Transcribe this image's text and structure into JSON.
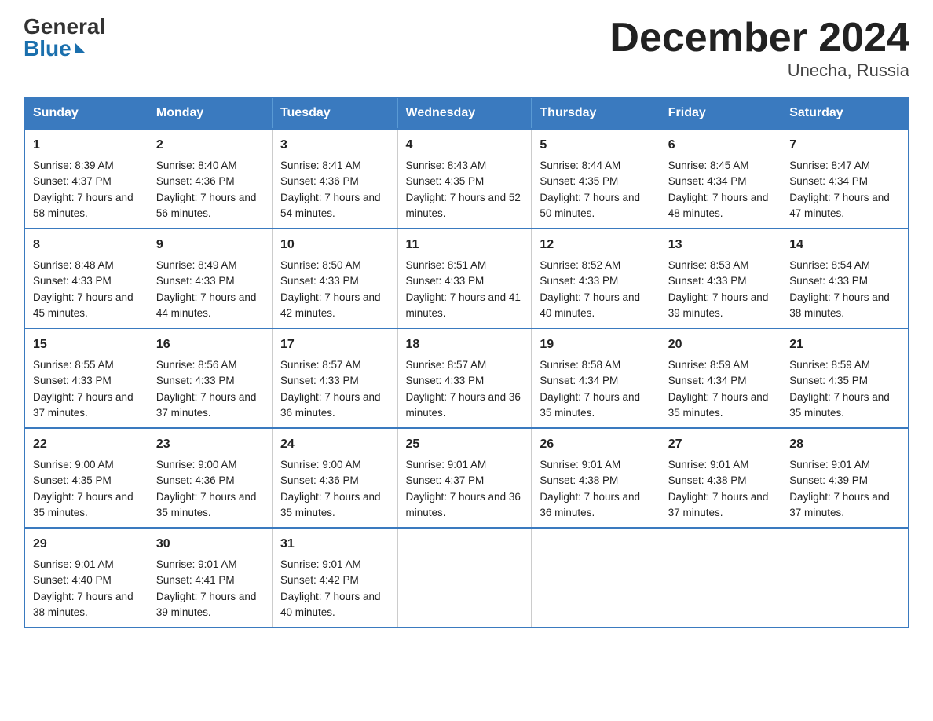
{
  "logo": {
    "general": "General",
    "blue": "Blue"
  },
  "title": "December 2024",
  "subtitle": "Unecha, Russia",
  "days_header": [
    "Sunday",
    "Monday",
    "Tuesday",
    "Wednesday",
    "Thursday",
    "Friday",
    "Saturday"
  ],
  "weeks": [
    [
      {
        "day": "1",
        "sunrise": "8:39 AM",
        "sunset": "4:37 PM",
        "daylight": "7 hours and 58 minutes."
      },
      {
        "day": "2",
        "sunrise": "8:40 AM",
        "sunset": "4:36 PM",
        "daylight": "7 hours and 56 minutes."
      },
      {
        "day": "3",
        "sunrise": "8:41 AM",
        "sunset": "4:36 PM",
        "daylight": "7 hours and 54 minutes."
      },
      {
        "day": "4",
        "sunrise": "8:43 AM",
        "sunset": "4:35 PM",
        "daylight": "7 hours and 52 minutes."
      },
      {
        "day": "5",
        "sunrise": "8:44 AM",
        "sunset": "4:35 PM",
        "daylight": "7 hours and 50 minutes."
      },
      {
        "day": "6",
        "sunrise": "8:45 AM",
        "sunset": "4:34 PM",
        "daylight": "7 hours and 48 minutes."
      },
      {
        "day": "7",
        "sunrise": "8:47 AM",
        "sunset": "4:34 PM",
        "daylight": "7 hours and 47 minutes."
      }
    ],
    [
      {
        "day": "8",
        "sunrise": "8:48 AM",
        "sunset": "4:33 PM",
        "daylight": "7 hours and 45 minutes."
      },
      {
        "day": "9",
        "sunrise": "8:49 AM",
        "sunset": "4:33 PM",
        "daylight": "7 hours and 44 minutes."
      },
      {
        "day": "10",
        "sunrise": "8:50 AM",
        "sunset": "4:33 PM",
        "daylight": "7 hours and 42 minutes."
      },
      {
        "day": "11",
        "sunrise": "8:51 AM",
        "sunset": "4:33 PM",
        "daylight": "7 hours and 41 minutes."
      },
      {
        "day": "12",
        "sunrise": "8:52 AM",
        "sunset": "4:33 PM",
        "daylight": "7 hours and 40 minutes."
      },
      {
        "day": "13",
        "sunrise": "8:53 AM",
        "sunset": "4:33 PM",
        "daylight": "7 hours and 39 minutes."
      },
      {
        "day": "14",
        "sunrise": "8:54 AM",
        "sunset": "4:33 PM",
        "daylight": "7 hours and 38 minutes."
      }
    ],
    [
      {
        "day": "15",
        "sunrise": "8:55 AM",
        "sunset": "4:33 PM",
        "daylight": "7 hours and 37 minutes."
      },
      {
        "day": "16",
        "sunrise": "8:56 AM",
        "sunset": "4:33 PM",
        "daylight": "7 hours and 37 minutes."
      },
      {
        "day": "17",
        "sunrise": "8:57 AM",
        "sunset": "4:33 PM",
        "daylight": "7 hours and 36 minutes."
      },
      {
        "day": "18",
        "sunrise": "8:57 AM",
        "sunset": "4:33 PM",
        "daylight": "7 hours and 36 minutes."
      },
      {
        "day": "19",
        "sunrise": "8:58 AM",
        "sunset": "4:34 PM",
        "daylight": "7 hours and 35 minutes."
      },
      {
        "day": "20",
        "sunrise": "8:59 AM",
        "sunset": "4:34 PM",
        "daylight": "7 hours and 35 minutes."
      },
      {
        "day": "21",
        "sunrise": "8:59 AM",
        "sunset": "4:35 PM",
        "daylight": "7 hours and 35 minutes."
      }
    ],
    [
      {
        "day": "22",
        "sunrise": "9:00 AM",
        "sunset": "4:35 PM",
        "daylight": "7 hours and 35 minutes."
      },
      {
        "day": "23",
        "sunrise": "9:00 AM",
        "sunset": "4:36 PM",
        "daylight": "7 hours and 35 minutes."
      },
      {
        "day": "24",
        "sunrise": "9:00 AM",
        "sunset": "4:36 PM",
        "daylight": "7 hours and 35 minutes."
      },
      {
        "day": "25",
        "sunrise": "9:01 AM",
        "sunset": "4:37 PM",
        "daylight": "7 hours and 36 minutes."
      },
      {
        "day": "26",
        "sunrise": "9:01 AM",
        "sunset": "4:38 PM",
        "daylight": "7 hours and 36 minutes."
      },
      {
        "day": "27",
        "sunrise": "9:01 AM",
        "sunset": "4:38 PM",
        "daylight": "7 hours and 37 minutes."
      },
      {
        "day": "28",
        "sunrise": "9:01 AM",
        "sunset": "4:39 PM",
        "daylight": "7 hours and 37 minutes."
      }
    ],
    [
      {
        "day": "29",
        "sunrise": "9:01 AM",
        "sunset": "4:40 PM",
        "daylight": "7 hours and 38 minutes."
      },
      {
        "day": "30",
        "sunrise": "9:01 AM",
        "sunset": "4:41 PM",
        "daylight": "7 hours and 39 minutes."
      },
      {
        "day": "31",
        "sunrise": "9:01 AM",
        "sunset": "4:42 PM",
        "daylight": "7 hours and 40 minutes."
      },
      {
        "day": "",
        "sunrise": "",
        "sunset": "",
        "daylight": ""
      },
      {
        "day": "",
        "sunrise": "",
        "sunset": "",
        "daylight": ""
      },
      {
        "day": "",
        "sunrise": "",
        "sunset": "",
        "daylight": ""
      },
      {
        "day": "",
        "sunrise": "",
        "sunset": "",
        "daylight": ""
      }
    ]
  ],
  "labels": {
    "sunrise_prefix": "Sunrise: ",
    "sunset_prefix": "Sunset: ",
    "daylight_prefix": "Daylight: "
  }
}
